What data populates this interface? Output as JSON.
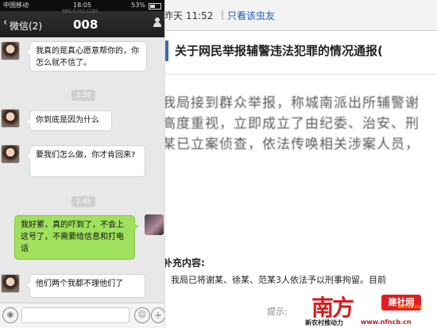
{
  "status_bar": {
    "carrier": "中国移动",
    "time": "18:05",
    "battery": "53%",
    "watermark": "BBS.E763.COM"
  },
  "chat": {
    "back_label": "微信(2)",
    "title": "008",
    "messages": [
      {
        "from": "other",
        "text": "我真的是真心愿意帮你的，你怎么就不信了。"
      },
      {
        "type": "timestamp",
        "text": "2:39"
      },
      {
        "from": "other",
        "text": "你到底是因为什么"
      },
      {
        "from": "other",
        "text": "要我们怎么做，你才肯回来?"
      },
      {
        "type": "timestamp",
        "text": "2:45"
      },
      {
        "from": "me",
        "text": "我好累，真的吓到了，不会上这号了，不需要给信息和打电话"
      },
      {
        "from": "other",
        "text": "他们两个我都不理他们了"
      }
    ],
    "input": {
      "placeholder": ""
    }
  },
  "post": {
    "header_time": "昨天 11:52",
    "separator": "|",
    "author_only_link": "只看该虫友",
    "title": "关于网民举报辅警违法犯罪的情况通报(",
    "body_lines": [
      "我局接到群众举报，称城南派出所辅警谢",
      "高度重视，立即成立了由纪委、治安、刑",
      "某已立案侦查，依法传唤相关涉案人员，"
    ],
    "supplement_title": "补充内容:",
    "supplement_text": "我局已将谢某、徐某、范某3人依法予以刑事拘留。目前",
    "hint": "提示:"
  },
  "watermark_logo": {
    "brand": "南方",
    "site": "建社网",
    "site_sub": "88148.com",
    "slogan": "新农村推动力",
    "url": "www.nfncb.cn"
  }
}
